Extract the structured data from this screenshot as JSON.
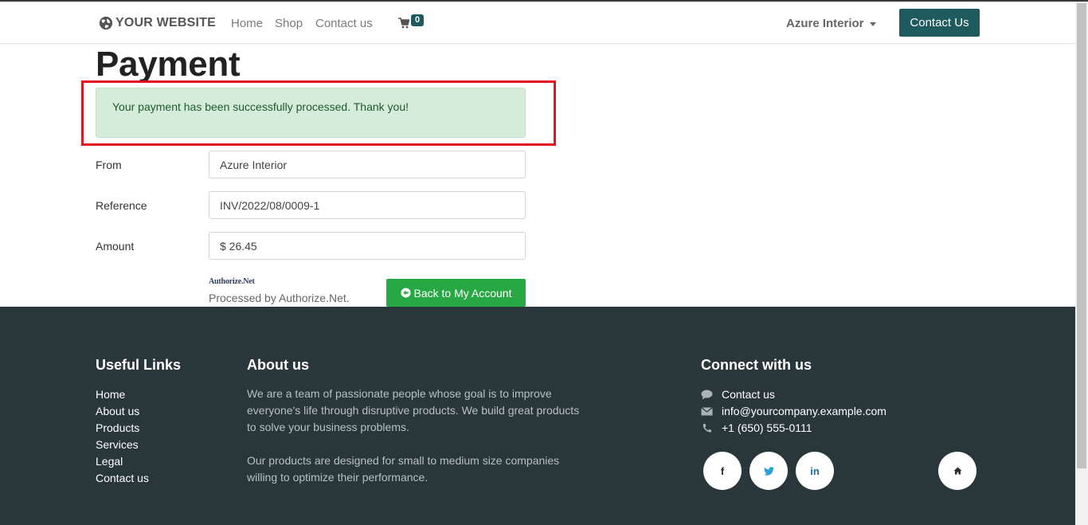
{
  "header": {
    "logo_text": "YOUR WEBSITE",
    "nav": [
      "Home",
      "Shop",
      "Contact us"
    ],
    "cart_count": "0",
    "user_name": "Azure Interior",
    "contact_button": "Contact Us"
  },
  "main": {
    "title": "Payment",
    "alert_message": "Your payment has been successfully processed. Thank you!",
    "fields": [
      {
        "label": "From",
        "value": "Azure Interior"
      },
      {
        "label": "Reference",
        "value": "INV/2022/08/0009-1"
      },
      {
        "label": "Amount",
        "value": "$ 26.45"
      }
    ],
    "provider_logo": "Authorize.Net",
    "processed_by": "Processed by Authorize.Net.",
    "back_button": "Back to My Account"
  },
  "footer": {
    "useful_links_heading": "Useful Links",
    "useful_links": [
      "Home",
      "About us",
      "Products",
      "Services",
      "Legal",
      "Contact us"
    ],
    "about_heading": "About us",
    "about_para1": "We are a team of passionate people whose goal is to improve everyone's life through disruptive products. We build great products to solve your business problems.",
    "about_para2": "Our products are designed for small to medium size companies willing to optimize their performance.",
    "connect_heading": "Connect with us",
    "contact_items": [
      {
        "icon": "comment-icon",
        "text": "Contact us"
      },
      {
        "icon": "envelope-icon",
        "text": "info@yourcompany.example.com"
      },
      {
        "icon": "phone-icon",
        "text": "+1 (650) 555-0111"
      }
    ],
    "social": [
      {
        "icon": "facebook-icon",
        "glyph": "f"
      },
      {
        "icon": "twitter-icon",
        "glyph": "🐦"
      },
      {
        "icon": "linkedin-icon",
        "glyph": "in"
      },
      {
        "icon": "home-icon",
        "glyph": "⌂"
      }
    ]
  },
  "colors": {
    "brand": "#1f5b5e",
    "success": "#28a745",
    "footer_bg": "#29363a",
    "alert_bg": "#d4ecd9",
    "highlight": "#e3141f"
  }
}
